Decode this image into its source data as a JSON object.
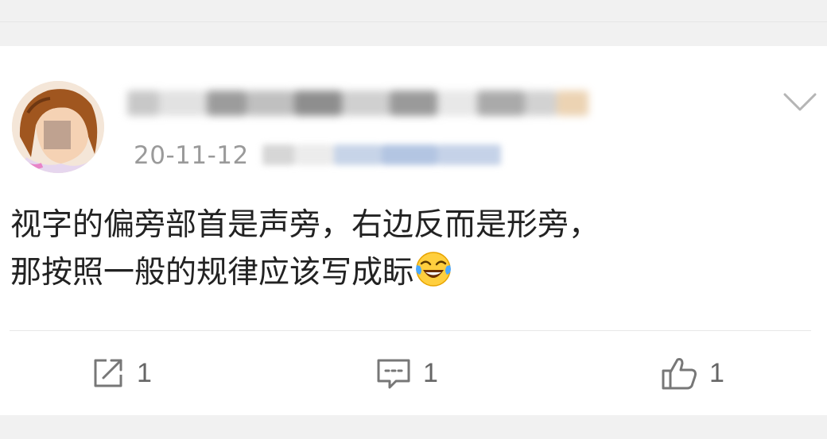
{
  "post": {
    "username": "",
    "timestamp": "20-11-12",
    "content_lines": [
      "视字的偏旁部首是声旁，右边反而是形旁，",
      "那按照一般的规律应该写成眎"
    ],
    "emoji": "laugh-cry-emoji",
    "actions": {
      "repost_count": "1",
      "comment_count": "1",
      "like_count": "1"
    }
  },
  "icons": {
    "more": "chevron-down-icon",
    "repost": "share-icon",
    "comment": "comment-icon",
    "like": "thumbs-up-icon"
  },
  "colors": {
    "text": "#222222",
    "meta": "#9a9a9a",
    "icon": "#777777",
    "background": "#f1f1f1",
    "card": "#ffffff"
  }
}
